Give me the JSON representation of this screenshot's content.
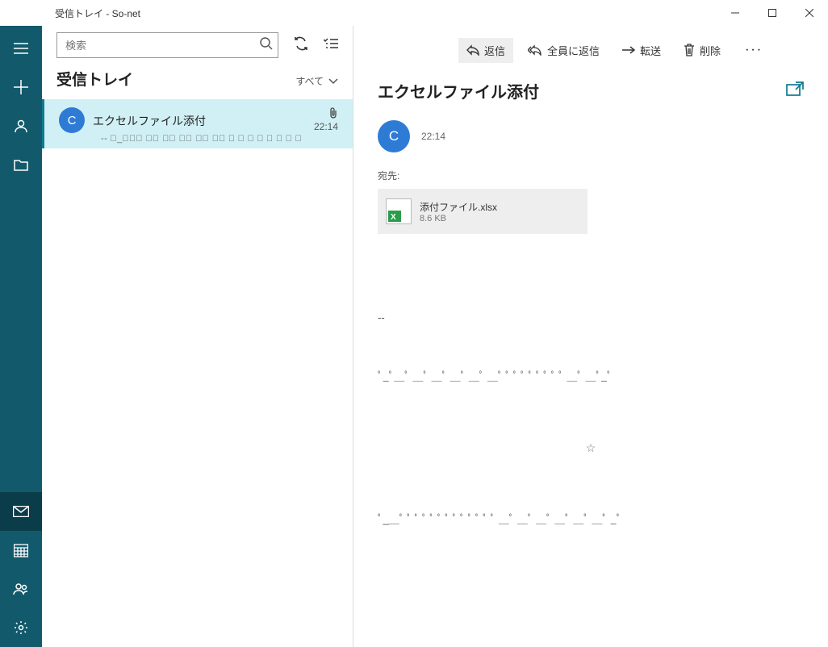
{
  "window": {
    "title": "受信トレイ - So-net"
  },
  "search": {
    "placeholder": "検索"
  },
  "list": {
    "folder_title": "受信トレイ",
    "filter_label": "すべて"
  },
  "message_item": {
    "avatar_initial": "C",
    "subject": "エクセルファイル添付",
    "time": "22:14",
    "preview": "-- ﾟ_ﾟ＿ﾟ ＿ﾟ ＿ﾟ ＿ﾟ ＿ﾟ ＿ﾟ ﾟ ﾟ ﾟ ﾟ ﾟ ﾟ ﾟ ﾟ"
  },
  "toolbar": {
    "reply": "返信",
    "reply_all": "全員に返信",
    "forward": "転送",
    "delete": "削除"
  },
  "content": {
    "subject": "エクセルファイル添付",
    "avatar_initial": "C",
    "time": "22:14",
    "to_label": "宛先:",
    "attachment": {
      "name": "添付ファイル.xlsx",
      "size": "8.6 KB"
    },
    "body_line1": "--",
    "body_line2": "ﾟ_ﾟ＿ﾟ  ＿ﾟ  ＿ﾟ  ＿ﾟ  ＿ﾟ  ＿ﾟ  ﾟ ﾟ ﾟ ﾟ ﾟ ﾟ ﾟ ﾟ  ＿ﾟ  ＿ﾟ_ﾟ",
    "star": "☆",
    "body_line3": "ﾟ_＿ﾟ ﾟ ﾟ ﾟ ﾟ ﾟ ﾟ ﾟ ﾟ ﾟ ﾟ ﾟ ﾟ  ＿ﾟ  ＿ﾟ  ＿ﾟ  ＿ﾟ  ＿ﾟ  ＿ﾟ  _ﾟ"
  }
}
